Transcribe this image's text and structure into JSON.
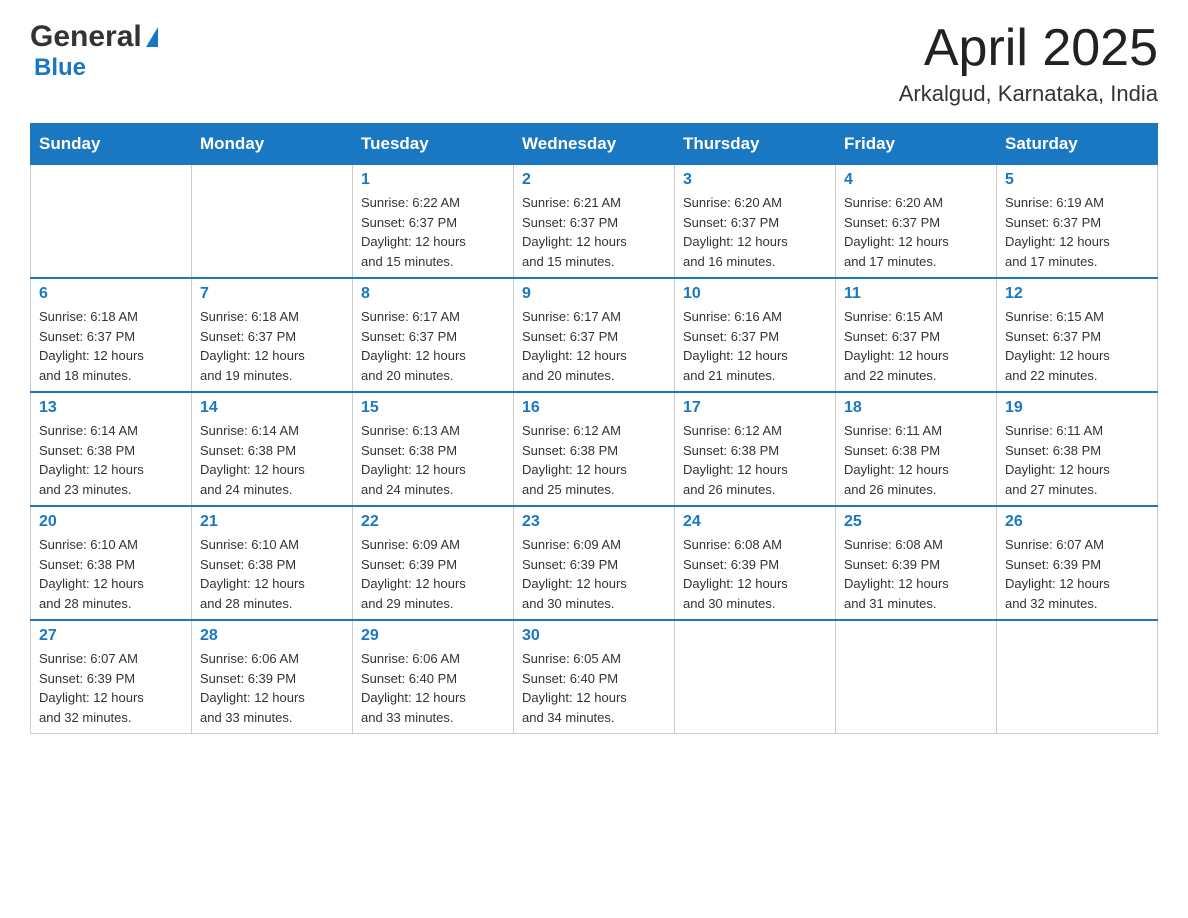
{
  "header": {
    "logo_general": "General",
    "logo_blue": "Blue",
    "title": "April 2025",
    "subtitle": "Arkalgud, Karnataka, India"
  },
  "weekdays": [
    "Sunday",
    "Monday",
    "Tuesday",
    "Wednesday",
    "Thursday",
    "Friday",
    "Saturday"
  ],
  "weeks": [
    [
      {
        "day": "",
        "info": ""
      },
      {
        "day": "",
        "info": ""
      },
      {
        "day": "1",
        "info": "Sunrise: 6:22 AM\nSunset: 6:37 PM\nDaylight: 12 hours\nand 15 minutes."
      },
      {
        "day": "2",
        "info": "Sunrise: 6:21 AM\nSunset: 6:37 PM\nDaylight: 12 hours\nand 15 minutes."
      },
      {
        "day": "3",
        "info": "Sunrise: 6:20 AM\nSunset: 6:37 PM\nDaylight: 12 hours\nand 16 minutes."
      },
      {
        "day": "4",
        "info": "Sunrise: 6:20 AM\nSunset: 6:37 PM\nDaylight: 12 hours\nand 17 minutes."
      },
      {
        "day": "5",
        "info": "Sunrise: 6:19 AM\nSunset: 6:37 PM\nDaylight: 12 hours\nand 17 minutes."
      }
    ],
    [
      {
        "day": "6",
        "info": "Sunrise: 6:18 AM\nSunset: 6:37 PM\nDaylight: 12 hours\nand 18 minutes."
      },
      {
        "day": "7",
        "info": "Sunrise: 6:18 AM\nSunset: 6:37 PM\nDaylight: 12 hours\nand 19 minutes."
      },
      {
        "day": "8",
        "info": "Sunrise: 6:17 AM\nSunset: 6:37 PM\nDaylight: 12 hours\nand 20 minutes."
      },
      {
        "day": "9",
        "info": "Sunrise: 6:17 AM\nSunset: 6:37 PM\nDaylight: 12 hours\nand 20 minutes."
      },
      {
        "day": "10",
        "info": "Sunrise: 6:16 AM\nSunset: 6:37 PM\nDaylight: 12 hours\nand 21 minutes."
      },
      {
        "day": "11",
        "info": "Sunrise: 6:15 AM\nSunset: 6:37 PM\nDaylight: 12 hours\nand 22 minutes."
      },
      {
        "day": "12",
        "info": "Sunrise: 6:15 AM\nSunset: 6:37 PM\nDaylight: 12 hours\nand 22 minutes."
      }
    ],
    [
      {
        "day": "13",
        "info": "Sunrise: 6:14 AM\nSunset: 6:38 PM\nDaylight: 12 hours\nand 23 minutes."
      },
      {
        "day": "14",
        "info": "Sunrise: 6:14 AM\nSunset: 6:38 PM\nDaylight: 12 hours\nand 24 minutes."
      },
      {
        "day": "15",
        "info": "Sunrise: 6:13 AM\nSunset: 6:38 PM\nDaylight: 12 hours\nand 24 minutes."
      },
      {
        "day": "16",
        "info": "Sunrise: 6:12 AM\nSunset: 6:38 PM\nDaylight: 12 hours\nand 25 minutes."
      },
      {
        "day": "17",
        "info": "Sunrise: 6:12 AM\nSunset: 6:38 PM\nDaylight: 12 hours\nand 26 minutes."
      },
      {
        "day": "18",
        "info": "Sunrise: 6:11 AM\nSunset: 6:38 PM\nDaylight: 12 hours\nand 26 minutes."
      },
      {
        "day": "19",
        "info": "Sunrise: 6:11 AM\nSunset: 6:38 PM\nDaylight: 12 hours\nand 27 minutes."
      }
    ],
    [
      {
        "day": "20",
        "info": "Sunrise: 6:10 AM\nSunset: 6:38 PM\nDaylight: 12 hours\nand 28 minutes."
      },
      {
        "day": "21",
        "info": "Sunrise: 6:10 AM\nSunset: 6:38 PM\nDaylight: 12 hours\nand 28 minutes."
      },
      {
        "day": "22",
        "info": "Sunrise: 6:09 AM\nSunset: 6:39 PM\nDaylight: 12 hours\nand 29 minutes."
      },
      {
        "day": "23",
        "info": "Sunrise: 6:09 AM\nSunset: 6:39 PM\nDaylight: 12 hours\nand 30 minutes."
      },
      {
        "day": "24",
        "info": "Sunrise: 6:08 AM\nSunset: 6:39 PM\nDaylight: 12 hours\nand 30 minutes."
      },
      {
        "day": "25",
        "info": "Sunrise: 6:08 AM\nSunset: 6:39 PM\nDaylight: 12 hours\nand 31 minutes."
      },
      {
        "day": "26",
        "info": "Sunrise: 6:07 AM\nSunset: 6:39 PM\nDaylight: 12 hours\nand 32 minutes."
      }
    ],
    [
      {
        "day": "27",
        "info": "Sunrise: 6:07 AM\nSunset: 6:39 PM\nDaylight: 12 hours\nand 32 minutes."
      },
      {
        "day": "28",
        "info": "Sunrise: 6:06 AM\nSunset: 6:39 PM\nDaylight: 12 hours\nand 33 minutes."
      },
      {
        "day": "29",
        "info": "Sunrise: 6:06 AM\nSunset: 6:40 PM\nDaylight: 12 hours\nand 33 minutes."
      },
      {
        "day": "30",
        "info": "Sunrise: 6:05 AM\nSunset: 6:40 PM\nDaylight: 12 hours\nand 34 minutes."
      },
      {
        "day": "",
        "info": ""
      },
      {
        "day": "",
        "info": ""
      },
      {
        "day": "",
        "info": ""
      }
    ]
  ]
}
